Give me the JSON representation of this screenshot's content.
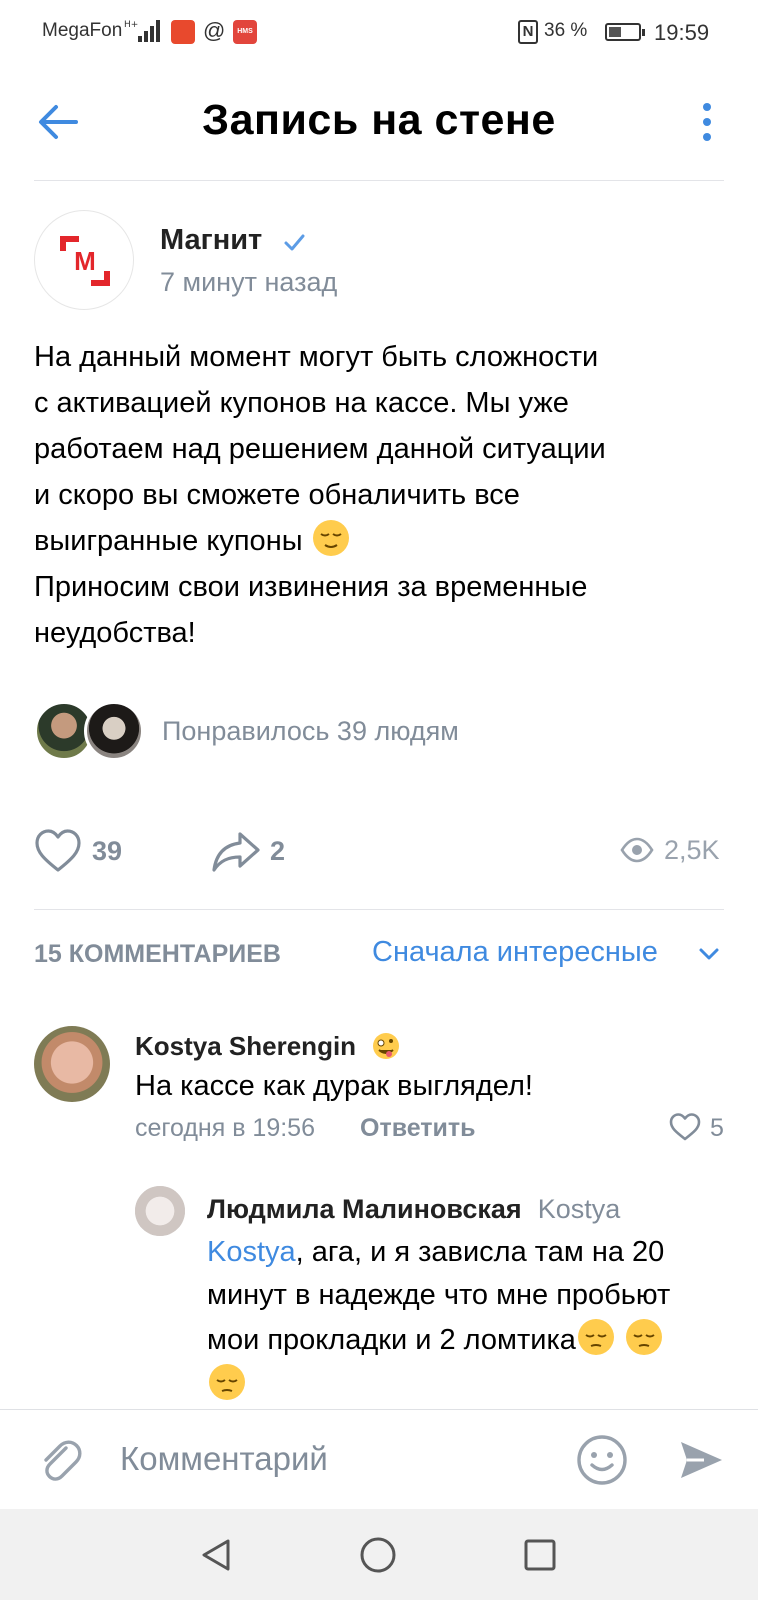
{
  "status_bar": {
    "carrier": "MegaFon",
    "network": "H+",
    "battery": "36 %",
    "battery_level": 0.36,
    "time": "19:59",
    "at_symbol": "@",
    "hms_label": "HMS",
    "nfc_label": "N"
  },
  "header": {
    "title": "Запись на стене"
  },
  "post": {
    "author": "Магнит",
    "logo_letter": "М",
    "time": "7 минут назад",
    "text_lines": [
      "На данный момент могут быть сложности",
      "с активацией купонов на кассе. Мы уже",
      "работаем над решением данной ситуации",
      "и скоро вы сможете обналичить все",
      "выигранные купоны",
      "Приносим свои извинения за временные",
      "неудобства!"
    ],
    "liked_by_text": "Понравилось 39 людям",
    "likes": "39",
    "shares": "2",
    "views": "2,5K"
  },
  "comments": {
    "count_label": "15 КОММЕНТАРИЕВ",
    "sort_label": "Сначала интересные",
    "items": [
      {
        "author": "Kostya Sherengin",
        "text": "На кассе как дурак выглядел!",
        "time": "сегодня в 19:56",
        "reply_label": "Ответить",
        "likes": "5"
      }
    ],
    "reply": {
      "author": "Людмила Малиновская",
      "reply_to": "Kostya",
      "mention": "Kostya",
      "text": ", ага, и я зависла там на 20 минут в надежде что мне пробьют мои прокладки и 2 ломтика"
    }
  },
  "composer": {
    "placeholder": "Комментарий"
  },
  "colors": {
    "accent": "#3f8ae0",
    "secondary_text": "#818c99",
    "brand_red": "#e3262b"
  },
  "icons": [
    "back-arrow-icon",
    "more-vertical-icon",
    "verified-check-icon",
    "heart-icon",
    "share-icon",
    "eye-icon",
    "chevron-down-icon",
    "paperclip-icon",
    "smile-icon",
    "send-icon",
    "nav-back-icon",
    "nav-home-icon",
    "nav-recents-icon"
  ]
}
